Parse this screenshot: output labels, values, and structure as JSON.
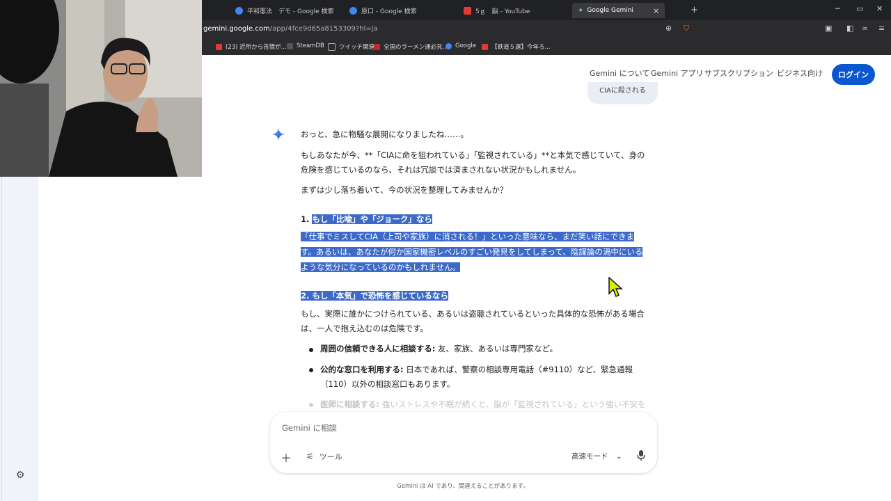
{
  "browser": {
    "tabs": [
      {
        "title": "平和憲法　デモ - Google 検索",
        "color": "#4285f4"
      },
      {
        "title": "原口 - Google 検索",
        "color": "#4285f4"
      },
      {
        "title": "5ｇ　脳 - YouTube",
        "color": "#e53935"
      },
      {
        "title": "Google Gemini",
        "color": "#8ab4f8"
      }
    ],
    "url_host": "gemini.google.com",
    "url_path": "/app/4fce9d65a8153309?hl=ja",
    "bookmarks": [
      {
        "label": "(23) 近所から苦情が...",
        "color": "#e53935"
      },
      {
        "label": "SteamDB",
        "color": "#555555"
      },
      {
        "label": "ツイッチ関連",
        "color": "#888888"
      },
      {
        "label": "全国のラーメン通必見...",
        "color": "#c62828"
      },
      {
        "label": "Google",
        "color": "#4285f4"
      },
      {
        "label": "【鉄道５選】今年ろ...",
        "color": "#e53935"
      }
    ],
    "new_tab_symbol": "+",
    "close_symbol": "×"
  },
  "header": {
    "nav": [
      "Gemini について",
      "Gemini アプリ",
      "サブスクリプション",
      "ビジネス向け"
    ],
    "login_label": "ログイン"
  },
  "prev_user_message": "CIAに殺される",
  "response": {
    "intro": "おっと、急に物騒な展開になりましたね……。",
    "para1_line1": "もしあなたが今、**「CIAに命を狙われている」「監視されている」**と本気で感じていて、身の",
    "para1_line2": "危険を感じているのなら、それは冗談では済まされない状況かもしれません。",
    "para2": "まずは少し落ち着いて、今の状況を整理してみませんか？",
    "section1_num": "1.",
    "section1_title": "もし「比喩」や「ジョーク」なら",
    "section1_line1": "「仕事でミスしてCIA（上司や家族）に消される！」といった意味なら、まだ笑い話にできま",
    "section1_line2": "す。あるいは、あなたが何か国家機密レベルのすごい発見をしてしまって、陰謀論の渦中にいる",
    "section1_line3": "ような気分になっているのかもしれません。",
    "section2_title": "2. もし「本気」で恐怖を感じているなら",
    "section2_line1": "もし、実際に誰かにつけられている、あるいは盗聴されているといった具体的な恐怖がある場合",
    "section2_line2": "は、一人で抱え込むのは危険です。",
    "bullets": [
      {
        "bold": "周囲の信頼できる人に相談する:",
        "text": " 友、家族、あるいは専門家など。"
      },
      {
        "bold": "公的な窓口を利用する:",
        "text": " 日本であれば、警察の相談専用電話（#9110）など、緊急通報",
        "text2": "（110）以外の相談窓口もあります。"
      },
      {
        "bold": "医師に相談する:",
        "text": " 強いストレスや不眠が続くと、脳が「監視されている」という強い不安を"
      }
    ]
  },
  "input": {
    "placeholder": "Gemini に相談",
    "tools_label": "ツール",
    "mode_label": "高速モード"
  },
  "footer": "Gemini は AI であり、間違えることがあります。"
}
